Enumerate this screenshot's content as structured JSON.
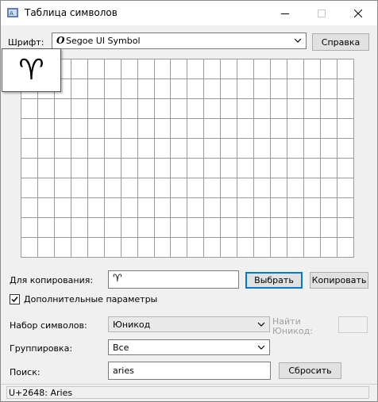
{
  "window": {
    "title": "Таблица символов",
    "title_icon": "char-map-app-icon"
  },
  "font": {
    "label": "Шрифт:",
    "selected": "Segoe UI Symbol",
    "font_type_glyph": "O",
    "help_button": "Справка"
  },
  "grid": {
    "columns": 20,
    "rows": 10,
    "magnified_char": "♈"
  },
  "copy": {
    "label": "Для копирования:",
    "value": "♈",
    "select_button": "Выбрать",
    "copy_button": "Копировать"
  },
  "advanced": {
    "checked": true,
    "label": "Дополнительные параметры"
  },
  "charset": {
    "label": "Набор символов:",
    "selected": "Юникод",
    "find_unicode_label_1": "Найти",
    "find_unicode_label_2": "Юникод:",
    "find_unicode_value": ""
  },
  "grouping": {
    "label": "Группировка:",
    "selected": "Все"
  },
  "search": {
    "label": "Поиск:",
    "value": "aries",
    "reset_button": "Сбросить"
  },
  "status": {
    "text": "U+2648: Aries"
  }
}
